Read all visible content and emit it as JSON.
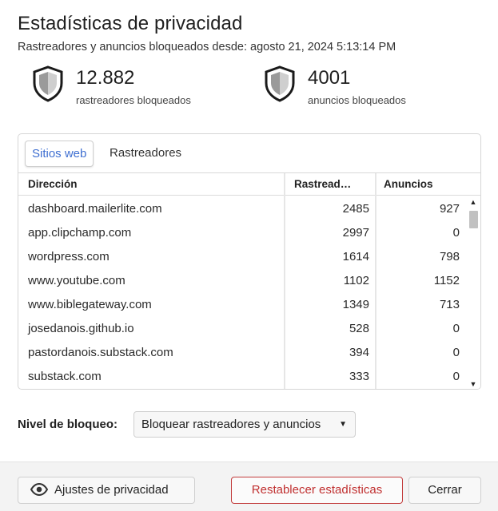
{
  "header": {
    "title": "Estadísticas de privacidad",
    "subtitle": "Rastreadores y anuncios bloqueados desde: agosto 21, 2024 5:13:14 PM"
  },
  "stats": {
    "trackers": {
      "count": "12.882",
      "label": "rastreadores bloqueados",
      "icon": "shield-icon"
    },
    "ads": {
      "count": "4001",
      "label": "anuncios bloqueados",
      "icon": "shield-icon"
    }
  },
  "tabs": [
    {
      "label": "Sitios web",
      "active": true
    },
    {
      "label": "Rastreadores",
      "active": false
    }
  ],
  "table": {
    "columns": [
      "Dirección",
      "Rastread…",
      "Anuncios"
    ],
    "rows": [
      {
        "address": "dashboard.mailerlite.com",
        "trackers": "2485",
        "ads": "927"
      },
      {
        "address": "app.clipchamp.com",
        "trackers": "2997",
        "ads": "0"
      },
      {
        "address": "wordpress.com",
        "trackers": "1614",
        "ads": "798"
      },
      {
        "address": "www.youtube.com",
        "trackers": "1102",
        "ads": "1152"
      },
      {
        "address": "www.biblegateway.com",
        "trackers": "1349",
        "ads": "713"
      },
      {
        "address": "josedanois.github.io",
        "trackers": "528",
        "ads": "0"
      },
      {
        "address": "pastordanois.substack.com",
        "trackers": "394",
        "ads": "0"
      },
      {
        "address": "substack.com",
        "trackers": "333",
        "ads": "0"
      }
    ]
  },
  "blocking": {
    "label": "Nivel de bloqueo:",
    "selected": "Bloquear rastreadores y anuncios"
  },
  "footer": {
    "privacy_button": "Ajustes de privacidad",
    "reset_button": "Restablecer estadísticas",
    "close_button": "Cerrar"
  },
  "colors": {
    "accent": "#3f6fd1",
    "danger": "#c03030"
  }
}
